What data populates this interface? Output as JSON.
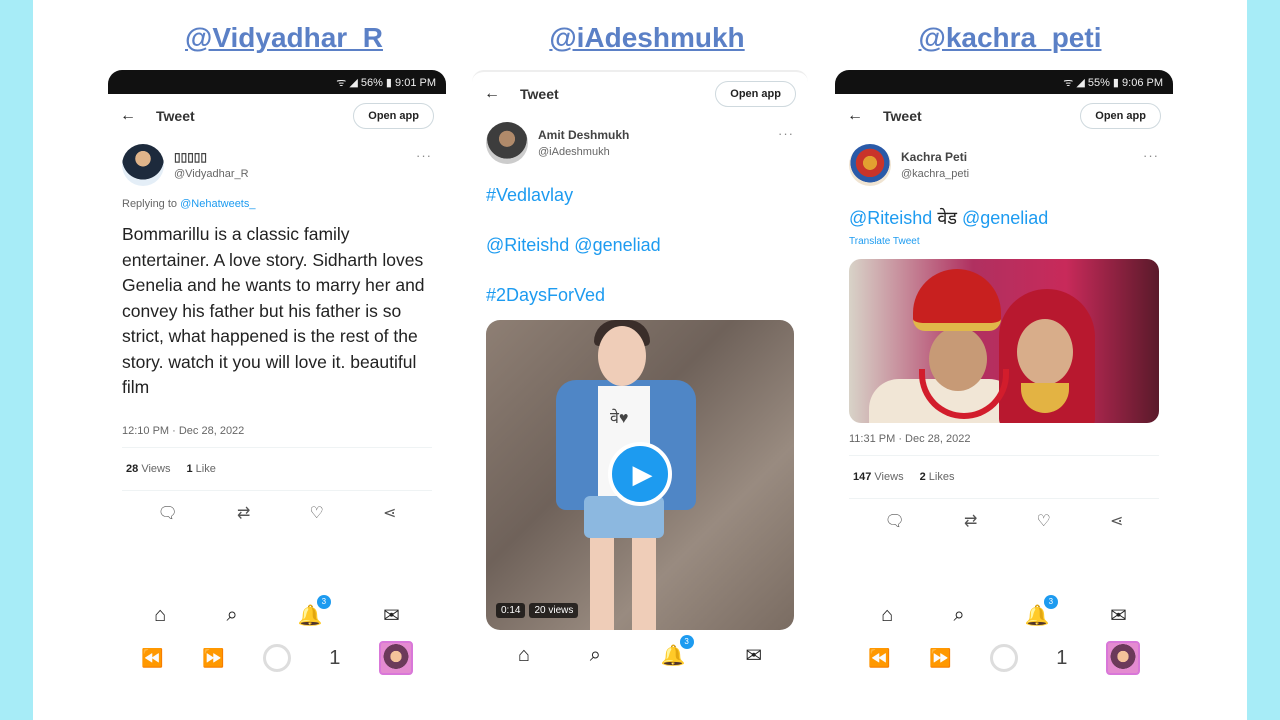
{
  "handles": [
    "@Vidyadhar_R",
    "@iAdeshmukh",
    "@kachra_peti"
  ],
  "colors": {
    "background": "#a7ecf7",
    "handle": "#5b80c6",
    "link": "#1d9bf0"
  },
  "common": {
    "tweet_title": "Tweet",
    "open_app": "Open app",
    "back_icon": "←",
    "more_icon": "···"
  },
  "phone1": {
    "status": "ᯤ ◢ 56% ▮ 9:01 PM",
    "display_name": "▯▯▯▯▯",
    "username": "@Vidyadhar_R",
    "replying_prefix": "Replying to",
    "replying_to": "@Nehatweets_",
    "text": "Bommarillu is a classic family entertainer. A love story. Sidharth loves Genelia and he wants to marry her and convey his father but his father is so strict, what happened is the rest of the story. watch it you will love it. beautiful film",
    "timestamp": "12:10 PM · Dec 28, 2022",
    "views_count": "28",
    "views_label": "Views",
    "likes_count": "1",
    "likes_label": "Like",
    "notif_badge": "3",
    "sys_count": "1"
  },
  "phone2": {
    "display_name": "Amit Deshmukh",
    "username": "@iAdeshmukh",
    "hashtag1": "#Vedlavlay",
    "mentions": "@Riteishd @geneliad",
    "hashtag2": "#2DaysForVed",
    "shirt_text": "वे♥",
    "video_duration": "0:14",
    "video_views": "20 views",
    "notif_badge": "3"
  },
  "phone3": {
    "status": "ᯤ ◢ 55% ▮ 9:06 PM",
    "display_name": "Kachra Peti",
    "username": "@kachra_peti",
    "mention1": "@Riteishd",
    "devanagari": "वेड",
    "mention2": "@geneliad",
    "translate": "Translate Tweet",
    "timestamp": "11:31 PM · Dec 28, 2022",
    "views_count": "147",
    "views_label": "Views",
    "likes_count": "2",
    "likes_label": "Likes",
    "notif_badge": "3",
    "sys_count": "1"
  },
  "icons": {
    "reply": "🗨",
    "retweet": "⇄",
    "like": "♡",
    "share": "⋖",
    "home": "⌂",
    "search": "⌕",
    "notifications": "🔔",
    "messages": "✉",
    "rewind": "⏪",
    "forward": "⏩",
    "play": "▶"
  }
}
